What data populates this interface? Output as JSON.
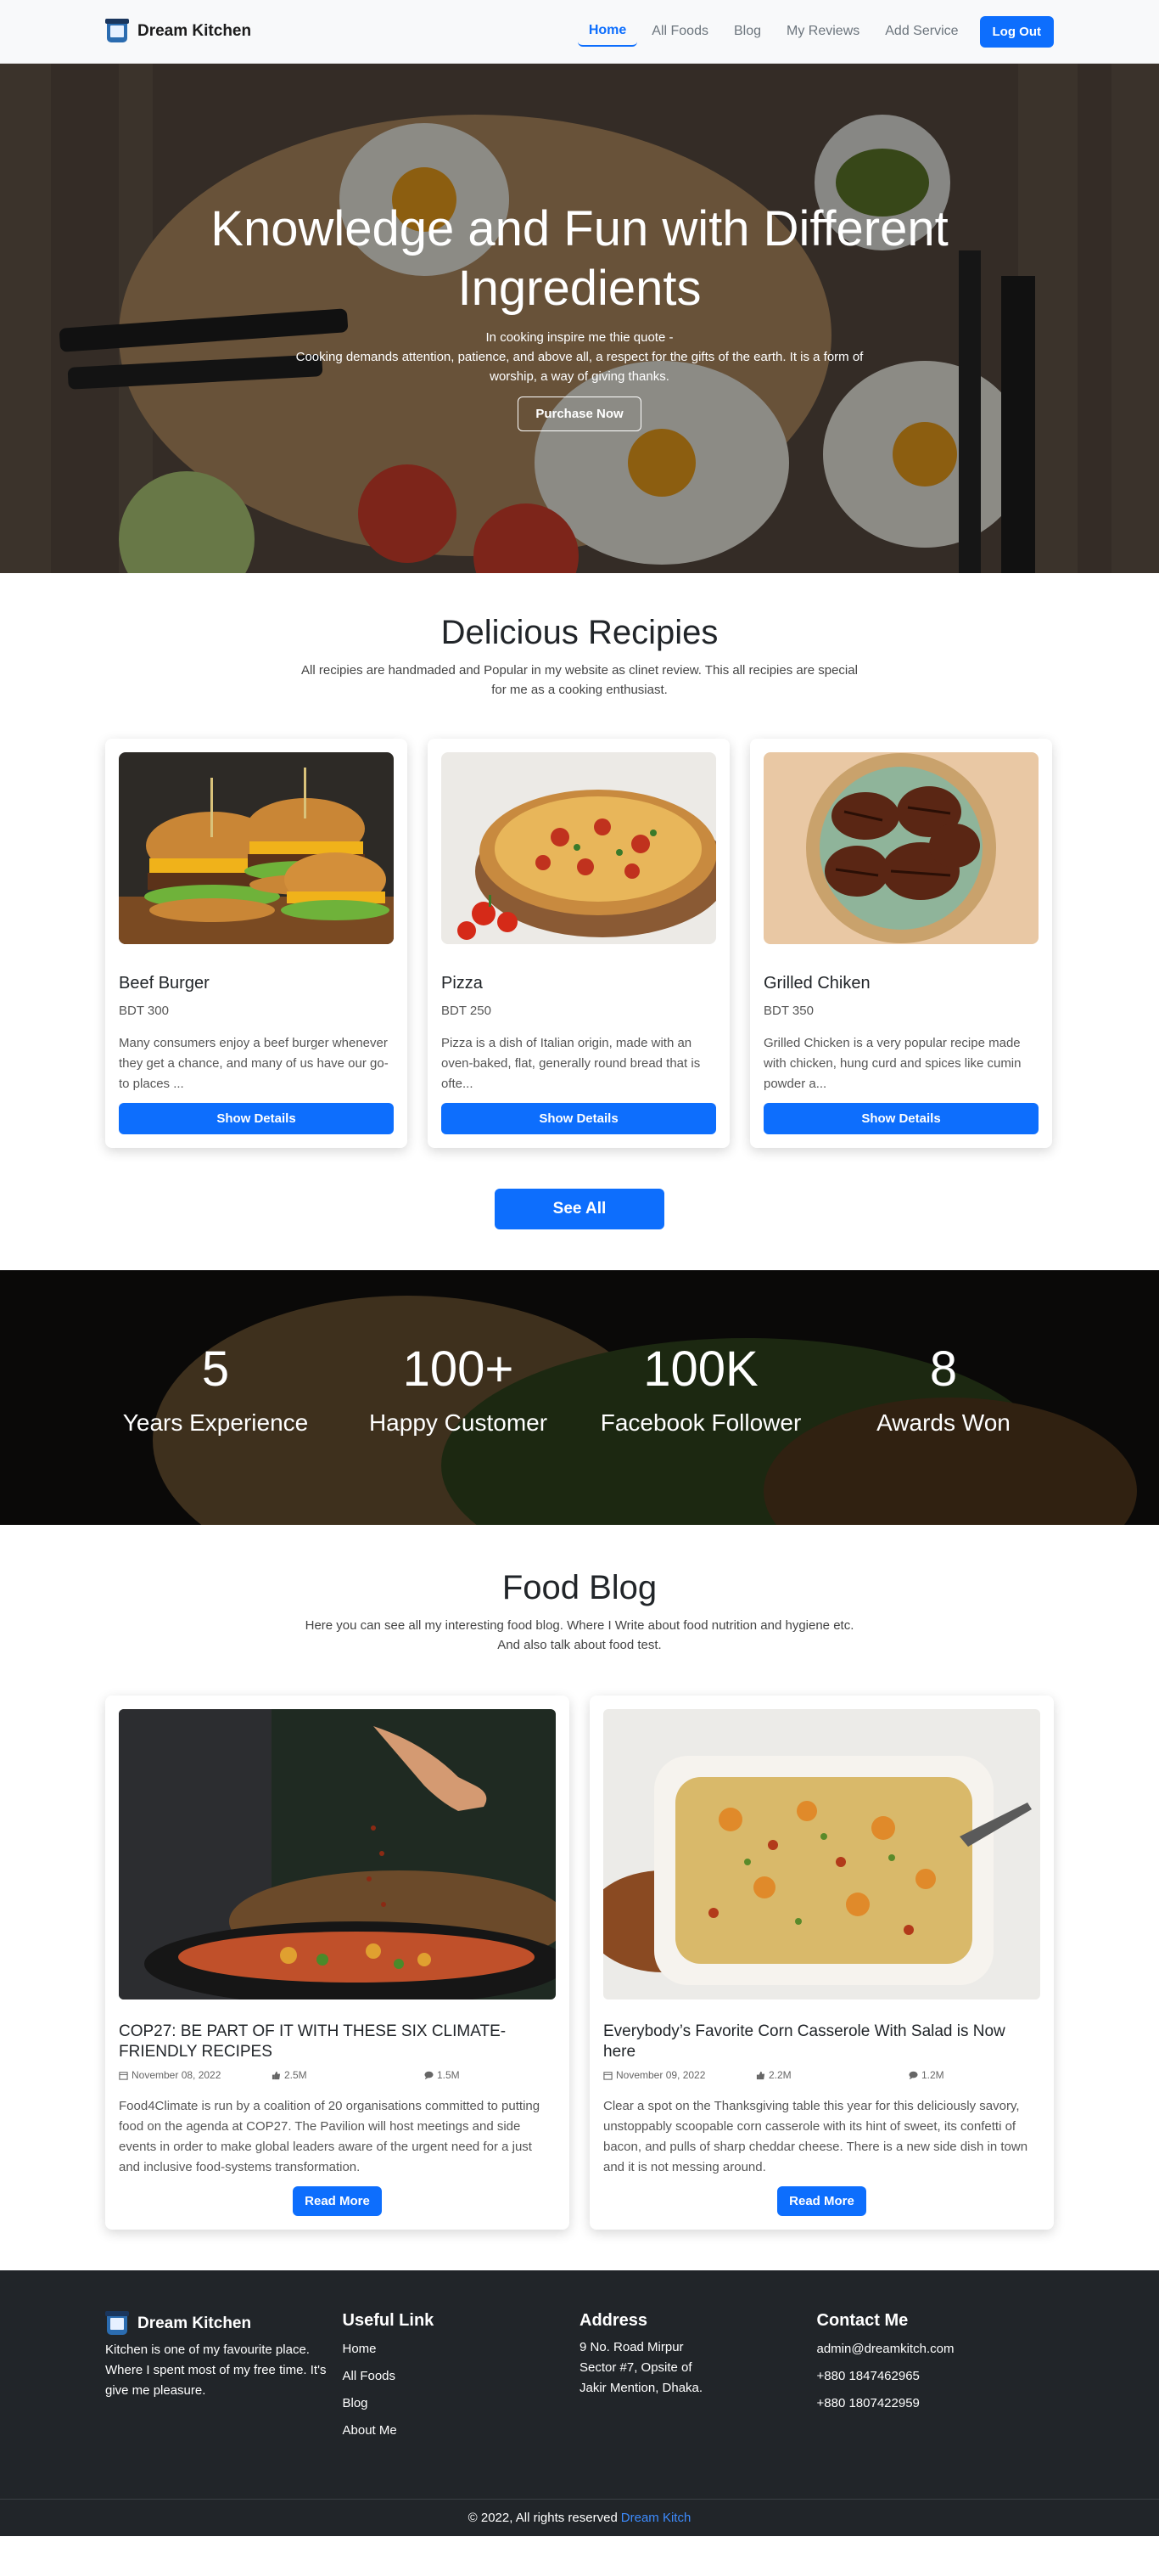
{
  "navbar": {
    "brand": "Dream Kitchen",
    "links": [
      "Home",
      "All Foods",
      "Blog",
      "My Reviews",
      "Add Service"
    ],
    "logout": "Log Out"
  },
  "hero": {
    "title": "Knowledge and Fun with Different Ingredients",
    "line1": "In cooking inspire me thie quote -",
    "line2": "Cooking demands attention, patience, and above all, a respect for the gifts of the earth. It is a form of worship, a way of giving thanks.",
    "button": "Purchase Now"
  },
  "recipes": {
    "title": "Delicious Recipies",
    "desc": "All recipies are handmaded and Popular in my website as clinet review. This all recipies are special for me as a cooking enthusiast.",
    "items": [
      {
        "name": "Beef Burger",
        "price": "BDT 300",
        "desc": "Many consumers enjoy a beef burger whenever they get a chance, and many of us have our go-to places ...",
        "button": "Show Details"
      },
      {
        "name": "Pizza",
        "price": "BDT 250",
        "desc": "Pizza is a dish of Italian origin, made with an oven-baked, flat, generally round bread that is ofte...",
        "button": "Show Details"
      },
      {
        "name": "Grilled Chiken",
        "price": "BDT 350",
        "desc": "Grilled Chicken is a very popular recipe made with chicken, hung curd and spices like cumin powder a...",
        "button": "Show Details"
      }
    ],
    "see_all": "See All"
  },
  "stats": [
    {
      "num": "5",
      "label": "Years Experience"
    },
    {
      "num": "100+",
      "label": "Happy Customer"
    },
    {
      "num": "100K",
      "label": "Facebook Follower"
    },
    {
      "num": "8",
      "label": "Awards Won"
    }
  ],
  "blog": {
    "title": "Food Blog",
    "desc": "Here you can see all my interesting food blog. Where I Write about food nutrition and hygiene etc. And also talk about food test.",
    "posts": [
      {
        "title": "COP27: BE PART OF IT WITH THESE SIX CLIMATE-FRIENDLY RECIPES",
        "date": "November 08, 2022",
        "likes": "2.5M",
        "comments": "1.5M",
        "desc": "Food4Climate is run by a coalition of 20 organisations committed to putting food on the agenda at COP27. The Pavilion will host meetings and side events in order to make global leaders aware of the urgent need for a just and inclusive food-systems transformation.",
        "button": "Read More"
      },
      {
        "title": "Everybody’s Favorite Corn Casserole With Salad is Now here",
        "date": "November 09, 2022",
        "likes": "2.2M",
        "comments": "1.2M",
        "desc": "Clear a spot on the Thanksgiving table this year for this deliciously savory, unstoppably scoopable corn casserole with its hint of sweet, its confetti of bacon, and pulls of sharp cheddar cheese. There is a new side dish in town and it is not messing around.",
        "button": "Read More"
      }
    ]
  },
  "footer": {
    "brand": "Dream Kitchen",
    "about": "Kitchen is one of my favourite place. Where I spent most of my free time. It's give me pleasure.",
    "useful_title": "Useful Link",
    "useful_links": [
      "Home",
      "All Foods",
      "Blog",
      "About Me"
    ],
    "address_title": "Address",
    "address": "9 No. Road Mirpur Sector #7, Opsite of Jakir Mention, Dhaka.",
    "contact_title": "Contact Me",
    "contact": [
      "admin@dreamkitch.com",
      "+880 1847462965",
      "+880 1807422959"
    ],
    "copyright": "© 2022, All rights reserved",
    "copyright_link": "Dream Kitch"
  },
  "colors": {
    "primary": "#0d6efd",
    "footer_bg": "#212529",
    "navbar_bg": "#f8f9fa"
  }
}
